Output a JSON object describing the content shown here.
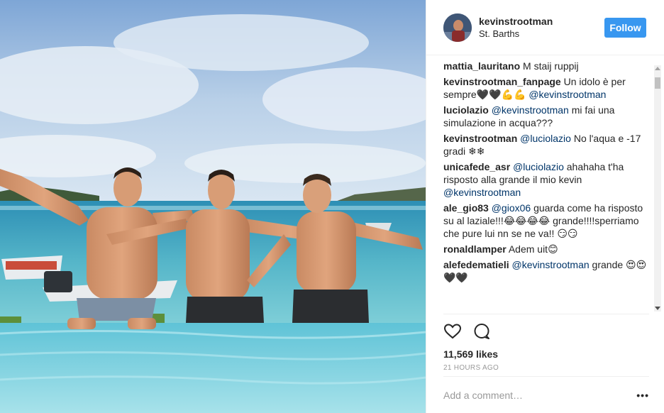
{
  "header": {
    "username": "kevinstrootman",
    "location": "St. Barths",
    "follow_label": "Follow"
  },
  "comments": [
    {
      "user": "mattia_lauritano",
      "parts": [
        {
          "t": "text",
          "v": "M staij ruppij"
        }
      ]
    },
    {
      "user": "kevinstrootman_fanpage",
      "parts": [
        {
          "t": "text",
          "v": "Un idolo è per sempre🖤🖤💪💪 "
        },
        {
          "t": "mention",
          "v": "@kevinstrootman"
        }
      ]
    },
    {
      "user": "luciolazio",
      "parts": [
        {
          "t": "mention",
          "v": "@kevinstrootman"
        },
        {
          "t": "text",
          "v": " mi fai una simulazione in acqua???"
        }
      ]
    },
    {
      "user": "kevinstrootman",
      "parts": [
        {
          "t": "mention",
          "v": "@luciolazio"
        },
        {
          "t": "text",
          "v": " No l'aqua e -17 gradi ❄❄"
        }
      ]
    },
    {
      "user": "unicafede_asr",
      "parts": [
        {
          "t": "mention",
          "v": "@luciolazio"
        },
        {
          "t": "text",
          "v": " ahahaha t'ha risposto alla grande il mio kevin "
        },
        {
          "t": "mention",
          "v": "@kevinstrootman"
        }
      ]
    },
    {
      "user": "ale_gio83",
      "parts": [
        {
          "t": "mention",
          "v": "@giox06"
        },
        {
          "t": "text",
          "v": " guarda come ha risposto su al laziale!!!😂😂😂😂 grande!!!!sperriamo che pure lui nn se ne va!! 😏😏"
        }
      ]
    },
    {
      "user": "ronaldlamper",
      "parts": [
        {
          "t": "text",
          "v": "Adem uit😊"
        }
      ]
    },
    {
      "user": "alefedematieli",
      "parts": [
        {
          "t": "mention",
          "v": "@kevinstrootman"
        },
        {
          "t": "text",
          "v": " grande 😍😍🖤🖤"
        }
      ]
    }
  ],
  "actions": {
    "like_icon": "heart-icon",
    "comment_icon": "comment-bubble-icon",
    "likes": "11,569 likes",
    "timestamp": "21 HOURS AGO"
  },
  "add_comment": {
    "placeholder": "Add a comment…",
    "more_label": "•••"
  },
  "colors": {
    "follow_button": "#3897f0",
    "mention": "#003569",
    "muted": "#999999"
  }
}
